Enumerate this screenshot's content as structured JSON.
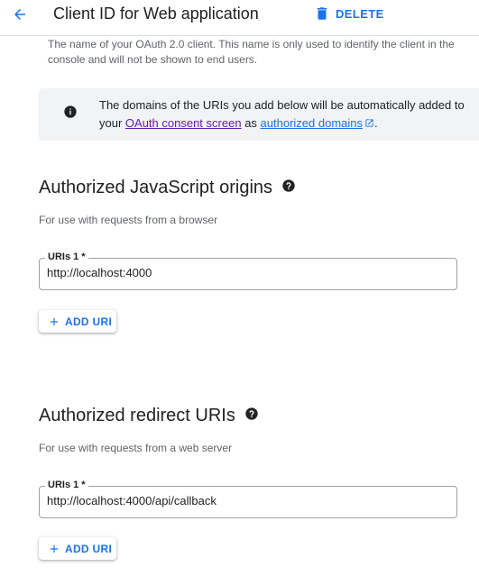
{
  "header": {
    "title": "Client ID for Web application",
    "delete_label": "DELETE",
    "back_icon": "arrow-back-icon",
    "delete_icon": "trash-icon"
  },
  "name_description": "The name of your OAuth 2.0 client. This name is only used to identify the client in the console and will not be shown to end users.",
  "info_box": {
    "text_before": "The domains of the URIs you add below will be automatically added to your",
    "link1": "OAuth consent screen",
    "text_middle": "as",
    "link2": "authorized domains",
    "text_end": "."
  },
  "js_origins": {
    "title": "Authorized JavaScript origins",
    "subtitle": "For use with requests from a browser",
    "field_label": "URIs 1 *",
    "field_value": "http://localhost:4000",
    "add_label": "ADD URI"
  },
  "redirect_uris": {
    "title": "Authorized redirect URIs",
    "subtitle": "For use with requests from a web server",
    "field_label": "URIs 1 *",
    "field_value": "http://localhost:4000/api/callback",
    "add_label": "ADD URI"
  },
  "colors": {
    "accent": "#1a73e8",
    "visited_link": "#681da8",
    "info_bg": "#f1f3f4"
  }
}
